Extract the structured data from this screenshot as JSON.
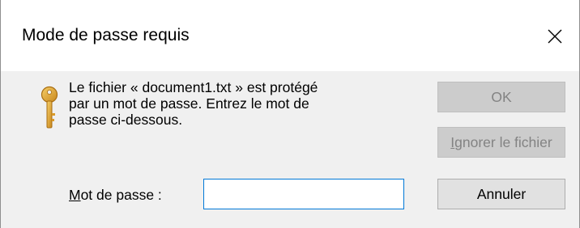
{
  "dialog": {
    "title": "Mode de passe requis",
    "close_glyph": "✕",
    "icon": "key-icon",
    "icon_color": "#e3a329",
    "message_lines": [
      "Le fichier « document1.txt » est protégé",
      "par un mot de passe. Entrez le mot de",
      "passe ci-dessous."
    ],
    "password": {
      "label_accel": "M",
      "label_rest": "ot de passe :",
      "value": "",
      "placeholder": ""
    },
    "buttons": {
      "ok_label": "OK",
      "ignore_accel": "I",
      "ignore_rest": "gnorer le fichier",
      "cancel_label": "Annuler"
    },
    "focus_color": "#0078d7"
  }
}
